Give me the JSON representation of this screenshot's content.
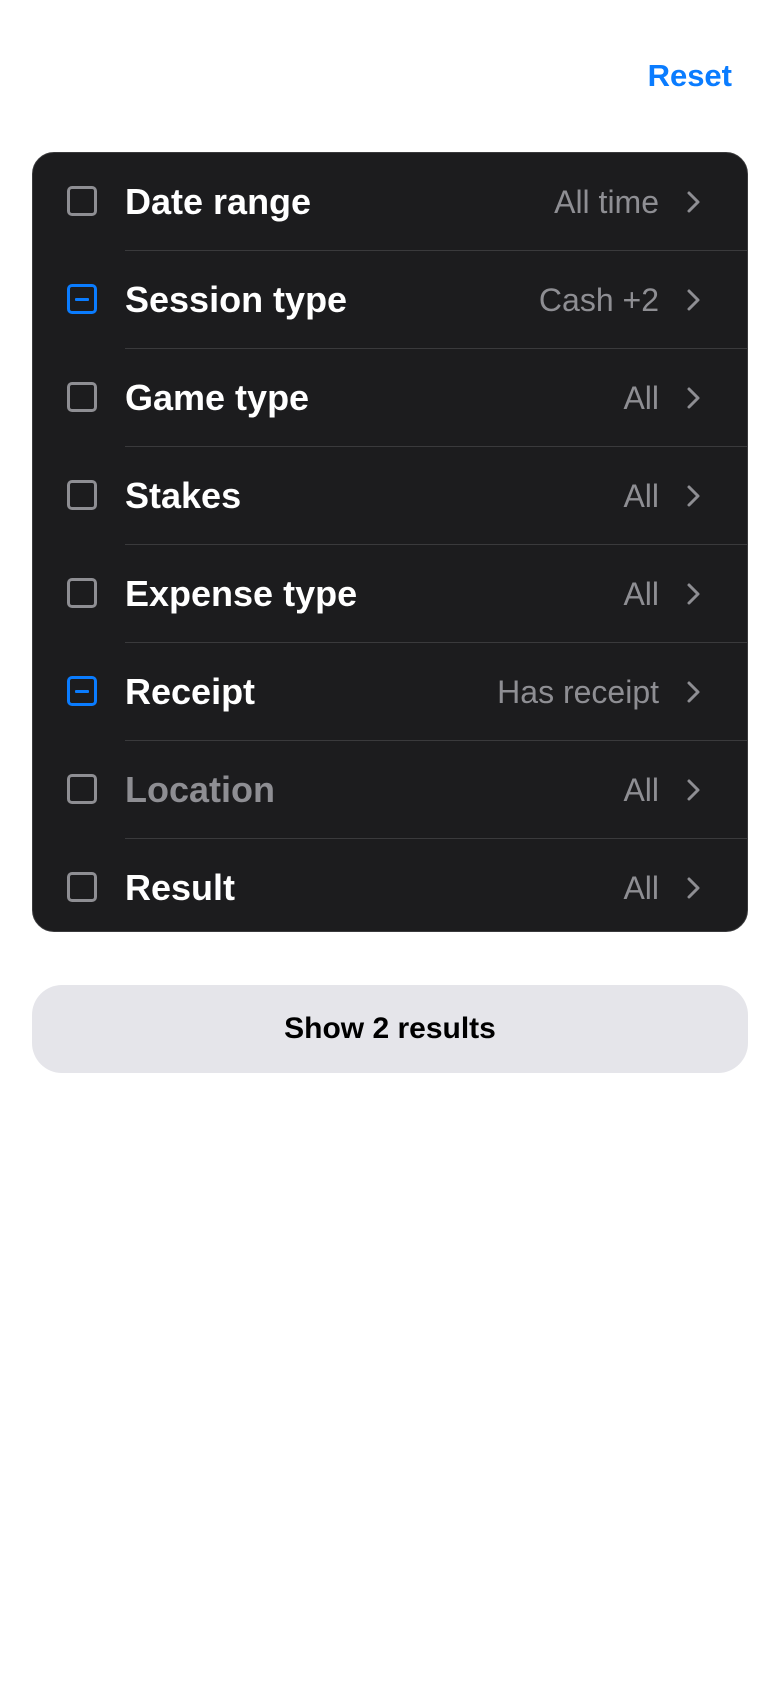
{
  "header": {
    "reset_label": "Reset"
  },
  "filters": [
    {
      "label": "Date range",
      "value": "All time",
      "checkbox": "empty"
    },
    {
      "label": "Session type",
      "value": "Cash +2",
      "checkbox": "partial"
    },
    {
      "label": "Game type",
      "value": "All",
      "checkbox": "empty"
    },
    {
      "label": "Stakes",
      "value": "All",
      "checkbox": "empty"
    },
    {
      "label": "Expense type",
      "value": "All",
      "checkbox": "empty"
    },
    {
      "label": "Receipt",
      "value": "Has receipt",
      "checkbox": "partial"
    },
    {
      "label": "Location",
      "value": "All",
      "checkbox": "empty",
      "disabled": true
    },
    {
      "label": "Result",
      "value": "All",
      "checkbox": "empty"
    }
  ],
  "footer": {
    "show_results_label": "Show 2 results"
  },
  "colors": {
    "accent": "#0a7cff",
    "card_background": "#1c1c1e",
    "secondary_text": "#8e8e93",
    "button_background": "#e5e5ea"
  },
  "icons": {
    "row_chevron": "chevron-right-icon",
    "partial_checkbox": "checkbox-indeterminate-icon",
    "empty_checkbox": "checkbox-empty-icon"
  }
}
